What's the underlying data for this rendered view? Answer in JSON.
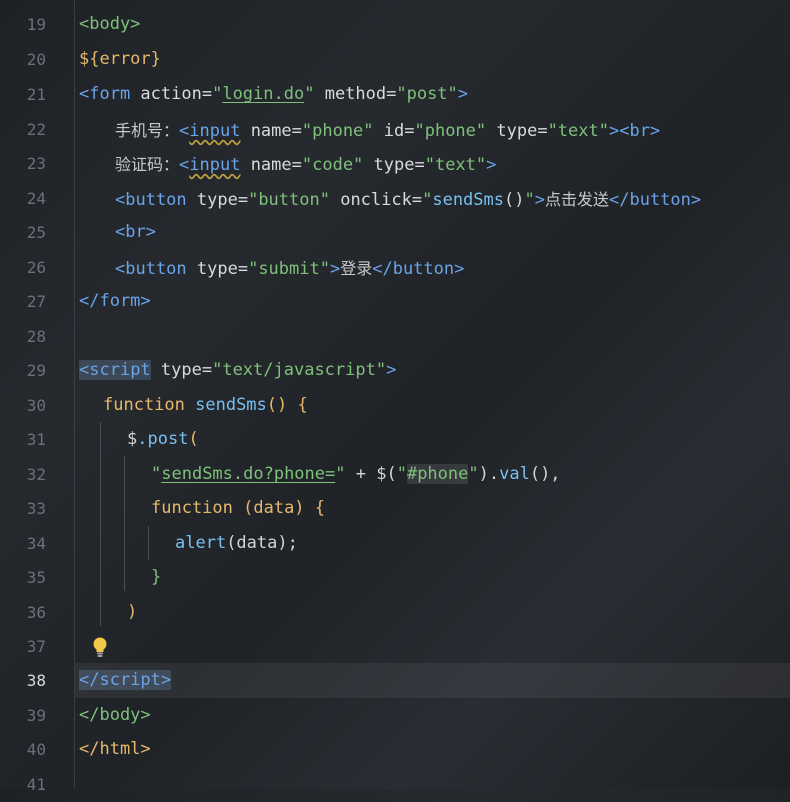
{
  "editor": {
    "line_numbers": [
      "19",
      "20",
      "21",
      "22",
      "23",
      "24",
      "25",
      "26",
      "27",
      "28",
      "29",
      "30",
      "31",
      "32",
      "33",
      "34",
      "35",
      "36",
      "37",
      "38",
      "39",
      "40",
      "41"
    ],
    "current_line": "38",
    "code": {
      "l19_tag": "<body>",
      "l20_var": "${error}",
      "l21_open": "<form",
      "l21_action_attr": " action=",
      "l21_action_q1": "\"",
      "l21_action_val": "login.do",
      "l21_action_q2": "\"",
      "l21_method_attr": " method=",
      "l21_method_val": "\"post\"",
      "l21_close": ">",
      "l22_label": "手机号：",
      "l22_open": "<",
      "l22_tagname": "input",
      "l22_name_attr": " name=",
      "l22_name_val": "\"phone\"",
      "l22_id_attr": " id=",
      "l22_id_val": "\"phone\"",
      "l22_type_attr": " type=",
      "l22_type_val": "\"text\"",
      "l22_close": "><br>",
      "l23_label": "验证码：",
      "l23_open": "<",
      "l23_tagname": "input",
      "l23_name_attr": " name=",
      "l23_name_val": "\"code\"",
      "l23_type_attr": " type=",
      "l23_type_val": "\"text\"",
      "l23_close": ">",
      "l24_open": "<button",
      "l24_type_attr": " type=",
      "l24_type_val": "\"button\"",
      "l24_onclick_attr": " onclick=",
      "l24_q1": "\"",
      "l24_fn": "sendSms",
      "l24_paren": "()",
      "l24_q2": "\"",
      "l24_gt": ">",
      "l24_text": "点击发送",
      "l24_end": "</button>",
      "l25_tag": "<br>",
      "l26_open": "<button",
      "l26_type_attr": " type=",
      "l26_type_val": "\"submit\"",
      "l26_gt": ">",
      "l26_text": "登录",
      "l26_end": "</button>",
      "l27_tag": "</form>",
      "l29_lt": "<",
      "l29_tagname": "script",
      "l29_type_attr": " type=",
      "l29_type_val": "\"text/javascript\"",
      "l29_gt": ">",
      "l30_kw": "function ",
      "l30_fn": "sendSms",
      "l30_rest": "() {",
      "l31_dollar": "$",
      "l31_post": ".post",
      "l31_paren": "(",
      "l32_q1": "\"",
      "l32_url": "sendSms.do?phone=",
      "l32_q2": "\"",
      "l32_plus": " + ",
      "l32_dollar": "$(",
      "l32_sq1": "\"",
      "l32_sel": "#phone",
      "l32_sq2": "\"",
      "l32_close": ").",
      "l32_val": "val",
      "l32_end": "(),",
      "l33_kw": "function ",
      "l33_rest": "(data) {",
      "l34_fn": "alert",
      "l34_rest": "(data);",
      "l35_brace": "}",
      "l36_paren": ")",
      "l38_lt": "</",
      "l38_tagname": "script",
      "l38_gt": ">",
      "l39_tag": "</body>",
      "l40_tag": "</html>"
    }
  },
  "icons": {
    "intention": "lightbulb-icon"
  },
  "colors": {
    "tag": "#6aa3e8",
    "string": "#7fc07a",
    "keyword": "#e6b86a",
    "function": "#78c0f0"
  }
}
